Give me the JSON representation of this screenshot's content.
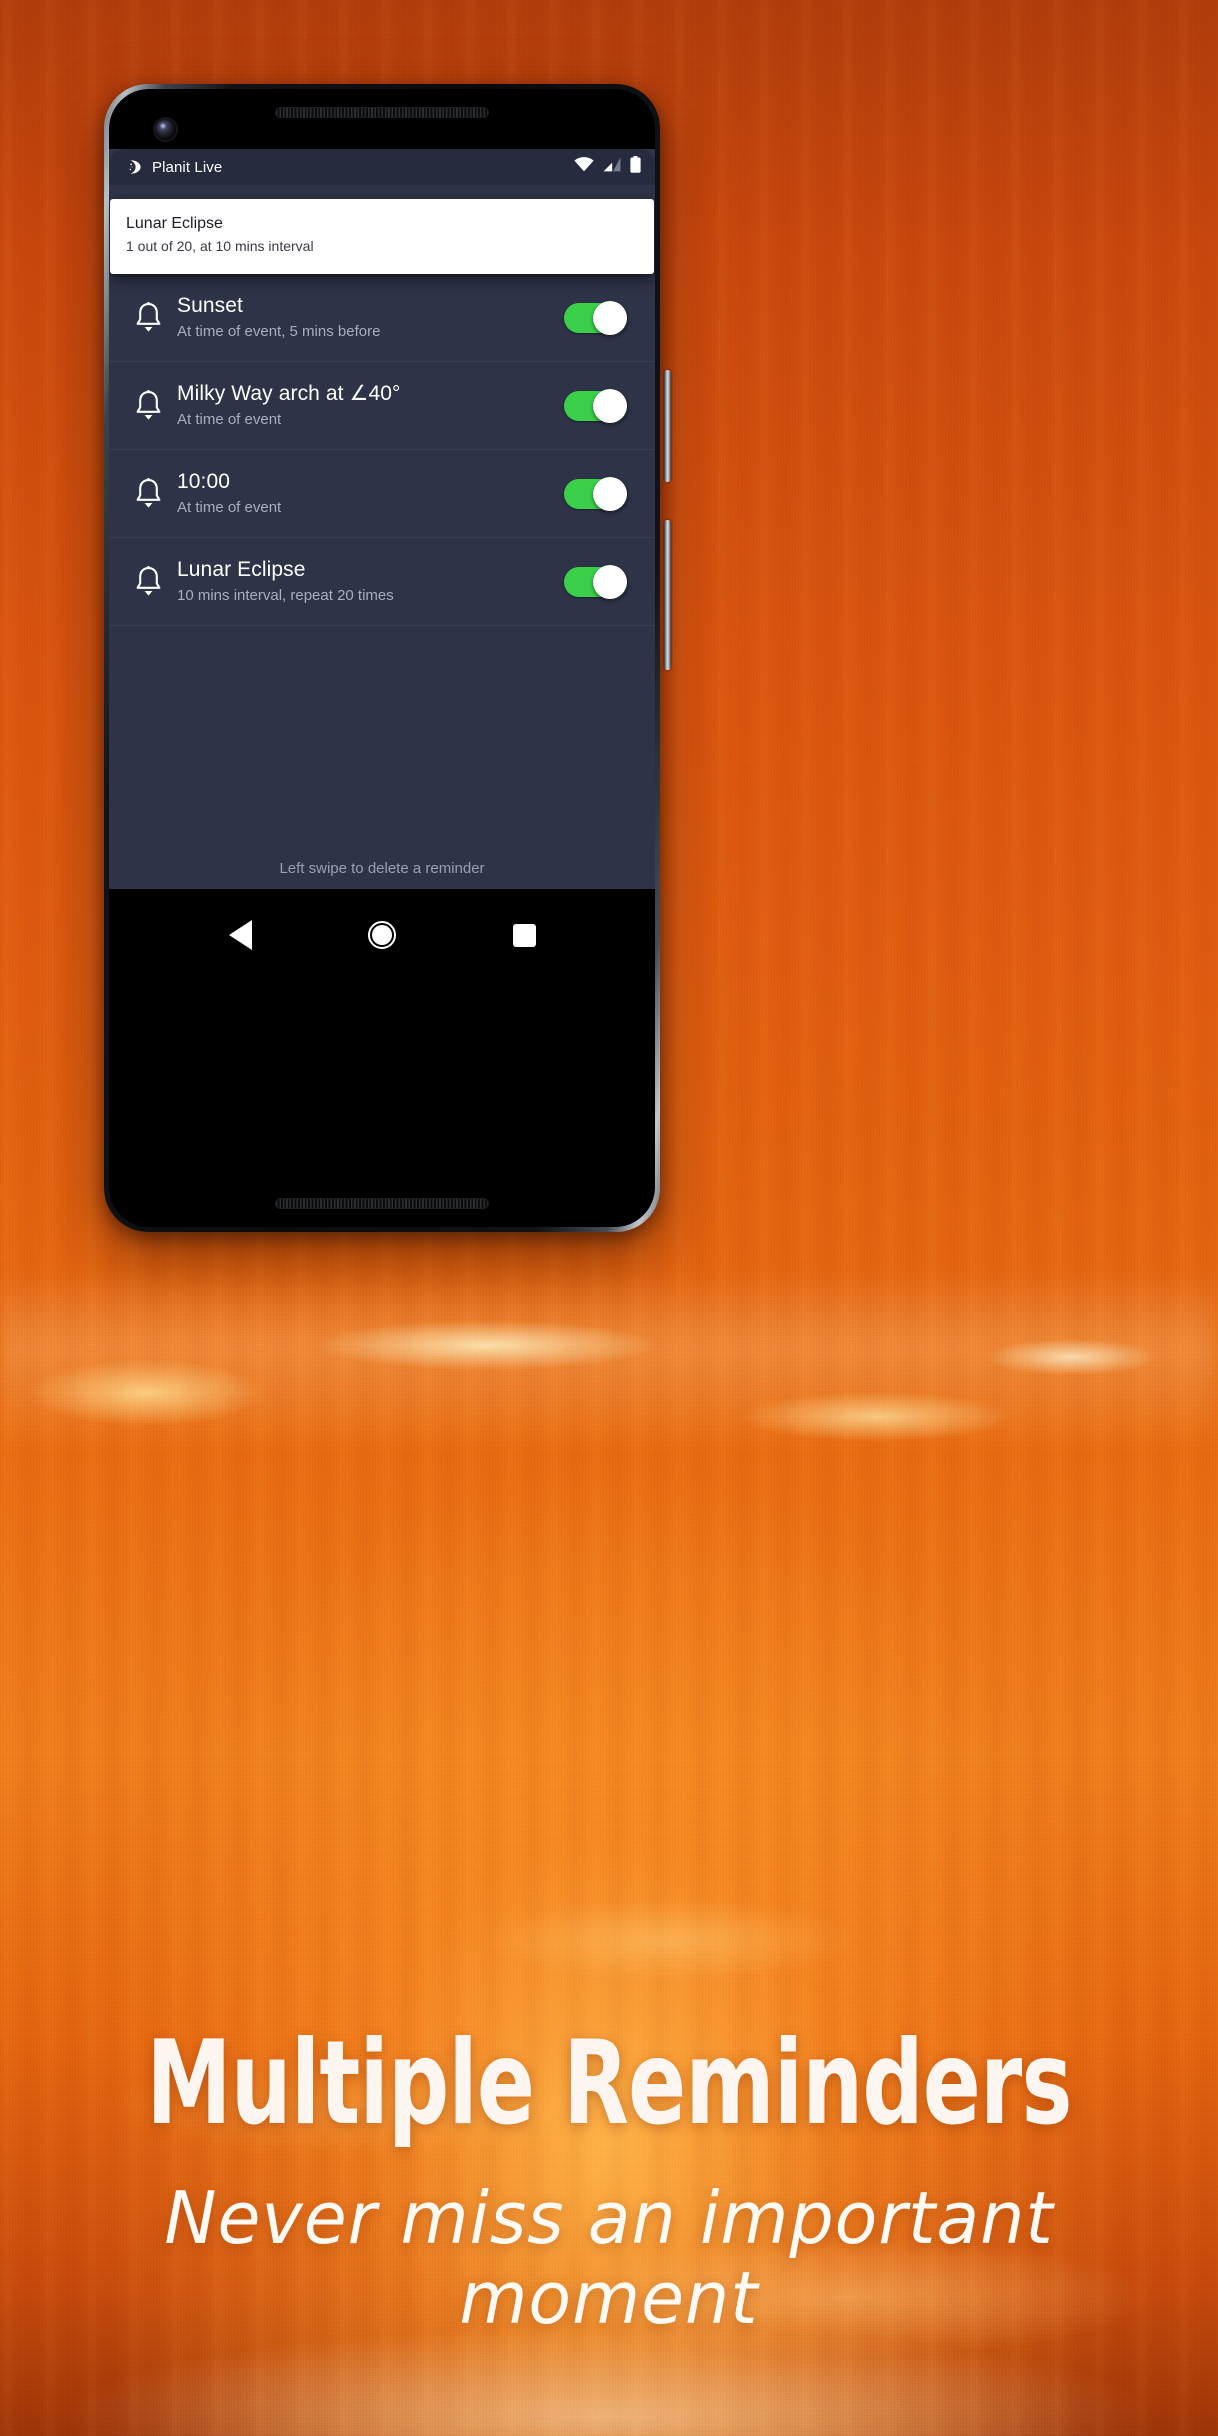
{
  "phone": {
    "status_bar": {
      "app_name": "Planit Live",
      "logo_icon": "planit-moon-logo",
      "icons": [
        "wifi-icon",
        "cellular-signal-icon",
        "battery-icon"
      ]
    },
    "drag_card": {
      "title": "Lunar Eclipse",
      "subtitle": "1 out of 20, at 10 mins interval"
    },
    "reminders": [
      {
        "icon": "bell-icon",
        "title": "Sunset",
        "subtitle": "At time of event, 5 mins before",
        "toggle_on": true
      },
      {
        "icon": "bell-icon",
        "title": "Milky Way arch at ∠40°",
        "subtitle": "At time of event",
        "toggle_on": true
      },
      {
        "icon": "bell-icon",
        "title": "10:00",
        "subtitle": "At time of event",
        "toggle_on": true
      },
      {
        "icon": "bell-icon",
        "title": "Lunar Eclipse",
        "subtitle": "10 mins interval, repeat 20 times",
        "toggle_on": true
      }
    ],
    "hint": "Left swipe to delete a reminder",
    "nav_bar": {
      "back": "back-triangle-icon",
      "home": "home-circle-icon",
      "recents": "recents-square-icon"
    }
  },
  "promo": {
    "headline": "Multiple Reminders",
    "subline": "Never miss an important moment"
  },
  "colors": {
    "accent_green": "#3ad04a",
    "screen_bg": "#2e3347",
    "status_bar_bg": "#262b3d",
    "background_orange": "#e2600f",
    "card_white": "#ffffff",
    "title_text": "#ffffff",
    "subtitle_text": "#a9aebd"
  }
}
